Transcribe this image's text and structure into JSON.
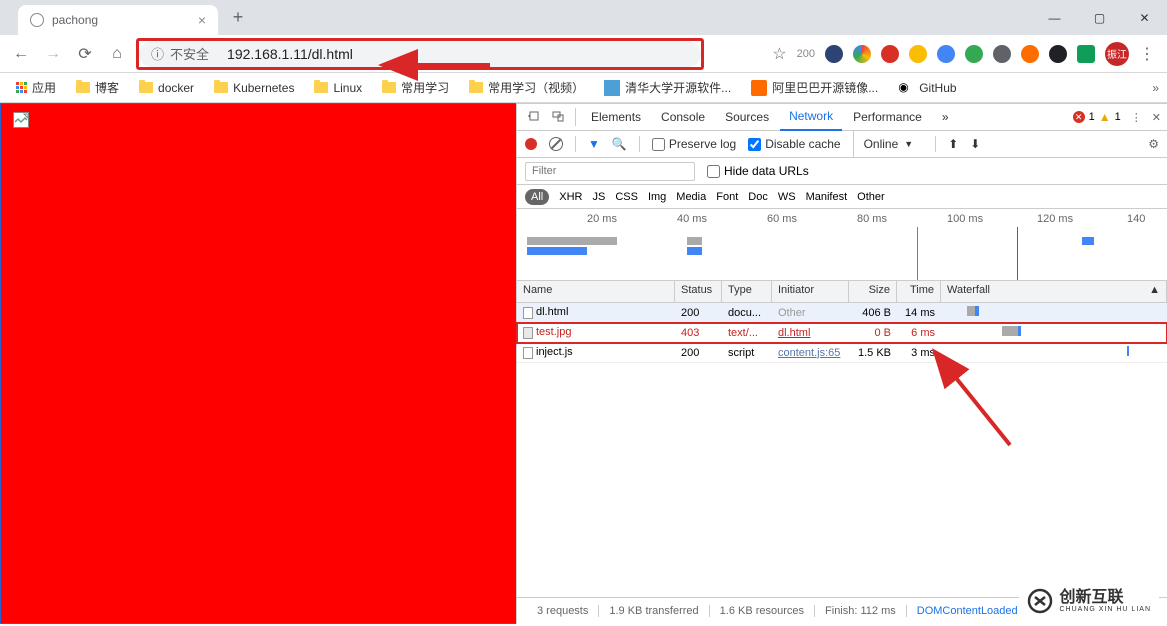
{
  "tab": {
    "title": "pachong"
  },
  "url": {
    "security": "不安全",
    "address": "192.168.1.11/dl.html",
    "badge_num": "200"
  },
  "bookmarks": {
    "apps": "应用",
    "items": [
      "博客",
      "docker",
      "Kubernetes",
      "Linux",
      "常用学习",
      "常用学习（视频）",
      "清华大学开源软件...",
      "阿里巴巴开源镜像...",
      "GitHub"
    ]
  },
  "devtools": {
    "tabs": [
      "Elements",
      "Console",
      "Sources",
      "Network",
      "Performance"
    ],
    "active_tab": "Network",
    "errors": "1",
    "warnings": "1",
    "toolbar": {
      "preserve": "Preserve log",
      "disable_cache": "Disable cache",
      "online": "Online"
    },
    "filter_placeholder": "Filter",
    "hide_urls": "Hide data URLs",
    "types": [
      "All",
      "XHR",
      "JS",
      "CSS",
      "Img",
      "Media",
      "Font",
      "Doc",
      "WS",
      "Manifest",
      "Other"
    ],
    "timeline_marks": [
      "20 ms",
      "40 ms",
      "60 ms",
      "80 ms",
      "100 ms",
      "120 ms",
      "140"
    ],
    "columns": [
      "Name",
      "Status",
      "Type",
      "Initiator",
      "Size",
      "Time",
      "Waterfall"
    ],
    "rows": [
      {
        "name": "dl.html",
        "status": "200",
        "type": "docu...",
        "initiator": "Other",
        "size": "406 B",
        "time": "14 ms"
      },
      {
        "name": "test.jpg",
        "status": "403",
        "type": "text/...",
        "initiator": "dl.html",
        "size": "0 B",
        "time": "6 ms"
      },
      {
        "name": "inject.js",
        "status": "200",
        "type": "script",
        "initiator": "content.js:65",
        "size": "1.5 KB",
        "time": "3 ms"
      }
    ],
    "summary": {
      "requests": "3 requests",
      "transferred": "1.9 KB transferred",
      "resources": "1.6 KB resources",
      "finish": "Finish: 112 ms",
      "dom": "DOMContentLoaded"
    }
  },
  "logo": "创新互联"
}
